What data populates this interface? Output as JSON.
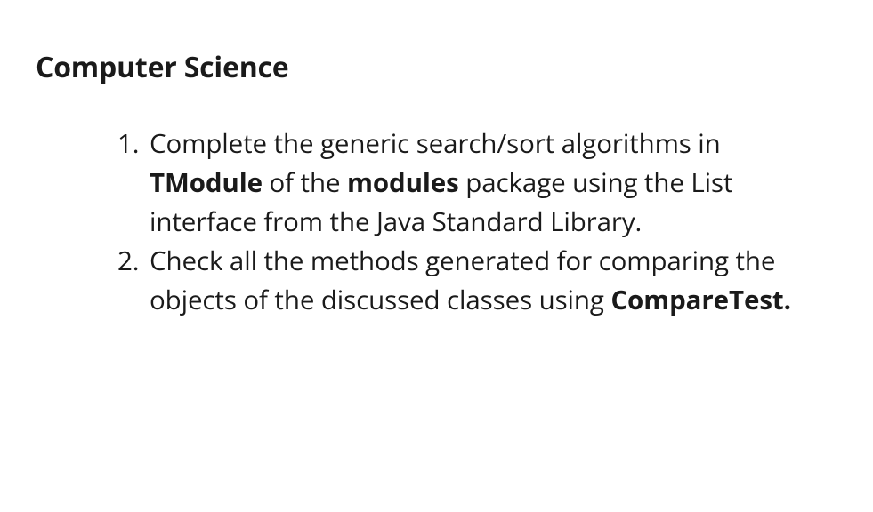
{
  "heading": "Computer Science",
  "items": [
    {
      "parts": [
        {
          "text": "Complete the generic search/sort algorithms in ",
          "bold": false
        },
        {
          "text": "TModule",
          "bold": true
        },
        {
          "text": " of the ",
          "bold": false
        },
        {
          "text": "modules",
          "bold": true
        },
        {
          "text": " package using the List interface from the Java Standard Library.",
          "bold": false
        }
      ]
    },
    {
      "parts": [
        {
          "text": "Check all the methods generated for comparing the objects of the discussed classes using ",
          "bold": false
        },
        {
          "text": "CompareTest.",
          "bold": true
        }
      ]
    }
  ]
}
